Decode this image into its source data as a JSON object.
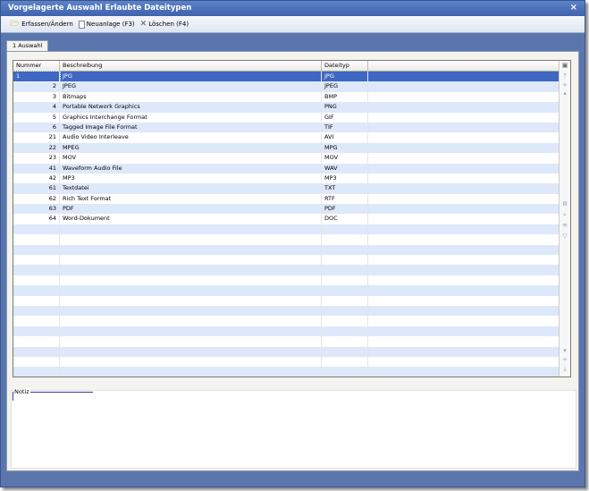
{
  "window": {
    "title": "Vorgelagerte Auswahl Erlaubte Dateitypen",
    "close": "×"
  },
  "toolbar": {
    "edit": "Erfassen/Ändern",
    "new": "Neuanlage (F3)",
    "delete": "Löschen (F4)"
  },
  "tabs": [
    {
      "label": "1 Auswahl"
    }
  ],
  "grid": {
    "columns": [
      "Nummer",
      "Beschreibung",
      "Dateityp"
    ],
    "rows": [
      [
        "1",
        "JPG",
        "JPG"
      ],
      [
        "2",
        "JPEG",
        "JPEG"
      ],
      [
        "3",
        "Bitmaps",
        "BMP"
      ],
      [
        "4",
        "Portable Network Graphics",
        "PNG"
      ],
      [
        "5",
        "Graphics Interchange Format",
        "GIF"
      ],
      [
        "6",
        "Tagged Image File Format",
        "TIF"
      ],
      [
        "21",
        "Audio Video Interleave",
        "AVI"
      ],
      [
        "22",
        "MPEG",
        "MPG"
      ],
      [
        "23",
        "MOV",
        "MOV"
      ],
      [
        "41",
        "Waveform Audio File",
        "WAV"
      ],
      [
        "42",
        "MP3",
        "MP3"
      ],
      [
        "61",
        "Textdatei",
        "TXT"
      ],
      [
        "62",
        "Rich Text Format",
        "RTF"
      ],
      [
        "63",
        "PDF",
        "PDF"
      ],
      [
        "64",
        "Word-Dokument",
        "DOC"
      ]
    ],
    "selected_row": 0
  },
  "notiz": {
    "label": "Notiz",
    "value": ""
  }
}
